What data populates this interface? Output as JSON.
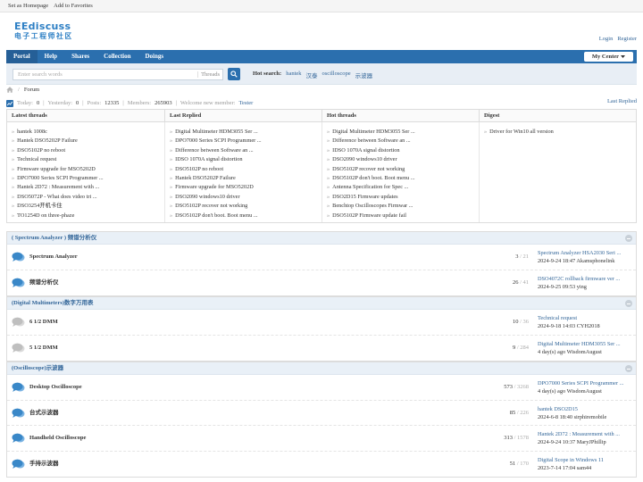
{
  "topbar": {
    "set_homepage": "Set as Homepage",
    "favorites": "Add to Favorites"
  },
  "logo": {
    "line1": "EEdiscuss",
    "line2": "电子工程师社区"
  },
  "userlinks": {
    "login": "Login",
    "register": "Register"
  },
  "nav": {
    "items": [
      "Portal",
      "Help",
      "Shares",
      "Collection",
      "Doings"
    ],
    "my_center": "My Center"
  },
  "search": {
    "placeholder": "Enter search words",
    "type": "Threads",
    "hot_label": "Hot search:",
    "hot_terms": [
      "hantek",
      "汉泰",
      "oscilloscope",
      "示波器"
    ]
  },
  "breadcrumb": {
    "current": "Forum"
  },
  "stats": {
    "today_label": "Today:",
    "today": "0",
    "yesterday_label": "Yesterday:",
    "yesterday": "0",
    "posts_label": "Posts:",
    "posts": "12335",
    "members_label": "Members:",
    "members": "265903",
    "welcome_label": "Welcome new member:",
    "welcome_user": "Tester",
    "last_replied": "Last Replied"
  },
  "threads_panel": {
    "headers": [
      "Latest threads",
      "Last Replied",
      "Hot threads",
      "Digest"
    ],
    "latest": [
      "hantek 1008c",
      "Hantek DSO5202P Failure",
      "DSO5102P no reboot",
      "Technical request",
      "Firmware upgrade for MSO5202D",
      "DPO7000 Series SCPI Programmer ...",
      "Hantek 2D72 : Measurement with ...",
      "DSO5072P - What does video tri ...",
      "DSO3254开机卡住",
      "TO1254D on three-phaze"
    ],
    "replied": [
      "Digital Multimeter HDM3055 Ser ...",
      "DPO7000 Series SCPI Programmer ...",
      "Difference between Software an ...",
      "IDSO 1070A signal distortion",
      "DSO5102P no reboot",
      "Hantek DSO5202P Failure",
      "Firmware upgrade for MSO5202D",
      "DSO2090 windows10 driver",
      "DSO5102P recover not working",
      "DSO5102P don't boot. Boot menu ..."
    ],
    "hot": [
      "Digital Multimeter HDM3055 Ser ...",
      "Difference between Software an ...",
      "IDSO 1070A signal distortion",
      "DSO2090 windows10 driver",
      "DSO5102P recover not working",
      "DSO5102P don't boot. Boot menu ...",
      "Antenna Specification for Spec ...",
      "DSO2D15 Firmware updates",
      "Benchtop Oscilloscopes Firmwar ...",
      "DSO5102P Firmware update fail"
    ],
    "digest": [
      "Driver for Win10 all version"
    ]
  },
  "categories": [
    {
      "title": "( Spectrum Analyzer ) 频谱分析仪",
      "forums": [
        {
          "name": "Spectrum Analyzer",
          "threads": "3",
          "posts": "21",
          "last_title": "Spectrum Analyzer HSA2030 Seri ...",
          "last_meta": "2024-9-24 18:47 Akamsphonelink",
          "active": true
        },
        {
          "name": "频谱分析仪",
          "threads": "26",
          "posts": "41",
          "last_title": "DSO4072C rollback firmware ver ...",
          "last_meta": "2024-9-25 09:53 ying",
          "active": true
        }
      ]
    },
    {
      "title": "(Digital Multimeters)数字万用表",
      "forums": [
        {
          "name": "6 1/2 DMM",
          "threads": "10",
          "posts": "36",
          "last_title": "Technical request",
          "last_meta": "2024-9-18 14:03 CYH2018",
          "active": false
        },
        {
          "name": "5 1/2 DMM",
          "threads": "9",
          "posts": "284",
          "last_title": "Digital Multimeter HDM3055 Ser ...",
          "last_meta": "4 day(s) ago WisdomAugust",
          "active": false
        }
      ]
    },
    {
      "title": "(Oscilloscope)示波器",
      "forums": [
        {
          "name": "Desktop Oscilloscope",
          "threads": "573",
          "posts": "3268",
          "last_title": "DPO7000 Series SCPI Programmer ...",
          "last_meta": "4 day(s) ago WisdomAugust",
          "active": true
        },
        {
          "name": "台式示波器",
          "threads": "85",
          "posts": "226",
          "last_title": "hantek DSO2D15",
          "last_meta": "2024-6-8 18:40 sirphiremobile",
          "active": true
        },
        {
          "name": "Handheld Oscilloscope",
          "threads": "313",
          "posts": "1578",
          "last_title": "Hantek 2D72 : Measurement with ...",
          "last_meta": "2024-9-24 10:37 MaryJPhillip",
          "active": true
        },
        {
          "name": "手持示波器",
          "threads": "51",
          "posts": "170",
          "last_title": "Digital Scope in Windows 11",
          "last_meta": "2023-7-14 17:04 sam44",
          "active": true
        }
      ]
    }
  ],
  "colors": {
    "nav_blue": "#2b6fae",
    "link_blue": "#336699",
    "category_bg": "#e9f0f7"
  }
}
